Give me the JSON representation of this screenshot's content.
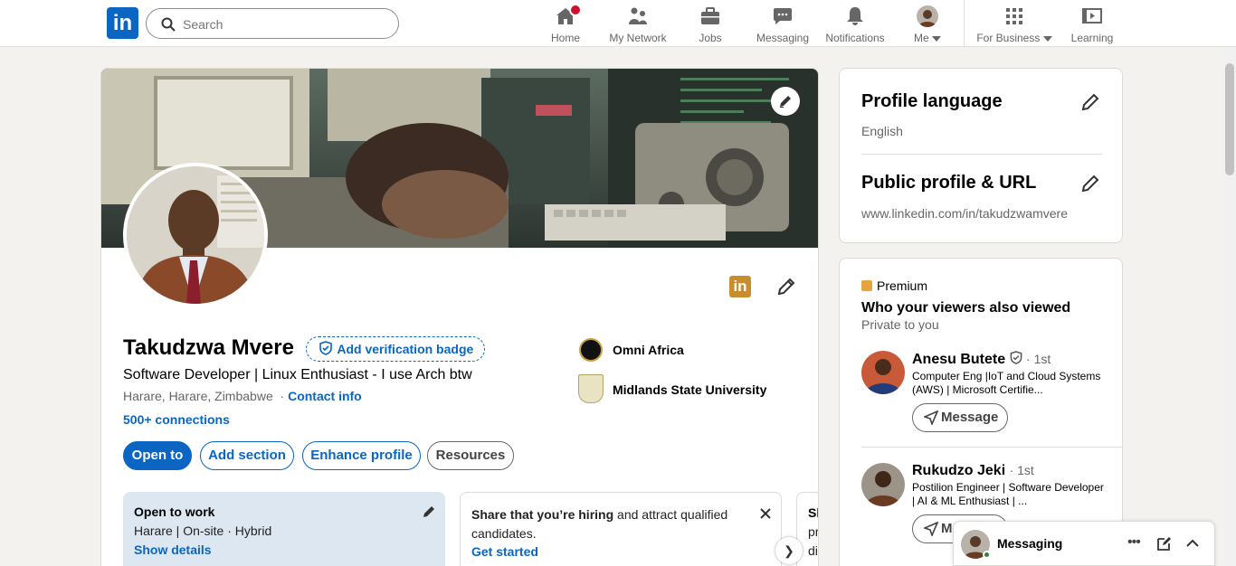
{
  "nav": {
    "logo_text": "in",
    "search_placeholder": "Search",
    "items": [
      {
        "label": "Home",
        "icon": "home-icon"
      },
      {
        "label": "My Network",
        "icon": "network-icon"
      },
      {
        "label": "Jobs",
        "icon": "briefcase-icon"
      },
      {
        "label": "Messaging",
        "icon": "messaging-icon"
      },
      {
        "label": "Notifications",
        "icon": "bell-icon"
      },
      {
        "label": "Me",
        "icon": "avatar"
      },
      {
        "label": "For Business",
        "icon": "grid-icon"
      },
      {
        "label": "Learning",
        "icon": "learning-icon"
      }
    ]
  },
  "profile": {
    "name": "Takudzwa Mvere",
    "verification_label": "Add verification badge",
    "headline": "Software Developer | Linux Enthusiast - I use Arch btw",
    "location": "Harare, Harare, Zimbabwe",
    "contact_sep": "·",
    "contact_info": "Contact info",
    "connections": "500+ connections",
    "logo_badge_text": "in",
    "buttons": {
      "open_to": "Open to",
      "add_section": "Add section",
      "enhance_profile": "Enhance profile",
      "resources": "Resources"
    },
    "orgs": [
      {
        "name": "Omni Africa"
      },
      {
        "name": "Midlands State University"
      }
    ]
  },
  "open_to_work": {
    "title": "Open to work",
    "detail": "Harare | On-site · Hybrid",
    "link": "Show details"
  },
  "hiring": {
    "bold": "Share that you’re hiring",
    "rest": " and attract qualified candidates.",
    "link": "Get started"
  },
  "third_card": {
    "line1": "Sl",
    "line2": "pr",
    "line3": "di"
  },
  "next_arrow": "❯",
  "sidebar": {
    "profile_language": {
      "title": "Profile language",
      "value": "English"
    },
    "public_profile": {
      "title": "Public profile & URL",
      "value": "www.linkedin.com/in/takudzwamvere"
    },
    "premium_label": "Premium",
    "viewers_title": "Who your viewers also viewed",
    "viewers_sub": "Private to you",
    "people": [
      {
        "name": "Anesu Butete",
        "degree": "· 1st",
        "headline": "Computer Eng |IoT and Cloud Systems (AWS) | Microsoft Certifie...",
        "button": "Message"
      },
      {
        "name": "Rukudzo Jeki",
        "degree": "· 1st",
        "headline": "Postilion Engineer | Software Developer | AI & ML Enthusiast | ...",
        "button": "Message"
      }
    ]
  },
  "messaging_bar": {
    "label": "Messaging"
  },
  "colors": {
    "brand": "#0a66c2",
    "premium": "#e7a33e",
    "notification": "#cb112d"
  }
}
